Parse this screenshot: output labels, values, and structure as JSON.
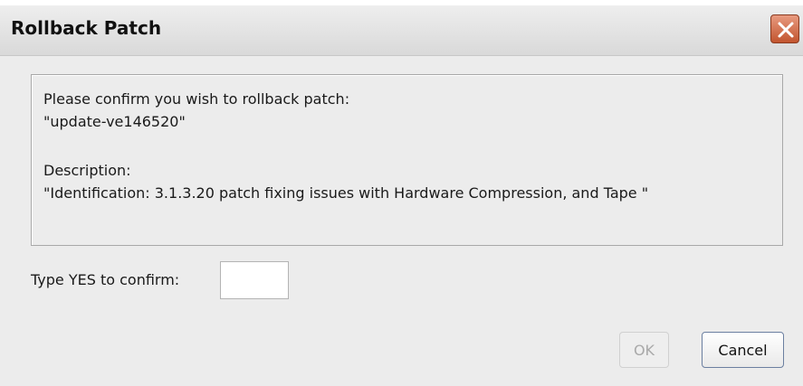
{
  "dialog": {
    "title": "Rollback Patch"
  },
  "message": {
    "line1": "Please confirm you wish to rollback patch:",
    "line2": "\"update-ve146520\"",
    "line3": "Description:",
    "line4": "\"Identification: 3.1.3.20 patch fixing issues with Hardware Compression, and Tape \""
  },
  "confirm": {
    "label": "Type YES to confirm:",
    "value": ""
  },
  "buttons": {
    "ok_label": "OK",
    "cancel_label": "Cancel"
  },
  "icons": {
    "close": "close-icon"
  }
}
